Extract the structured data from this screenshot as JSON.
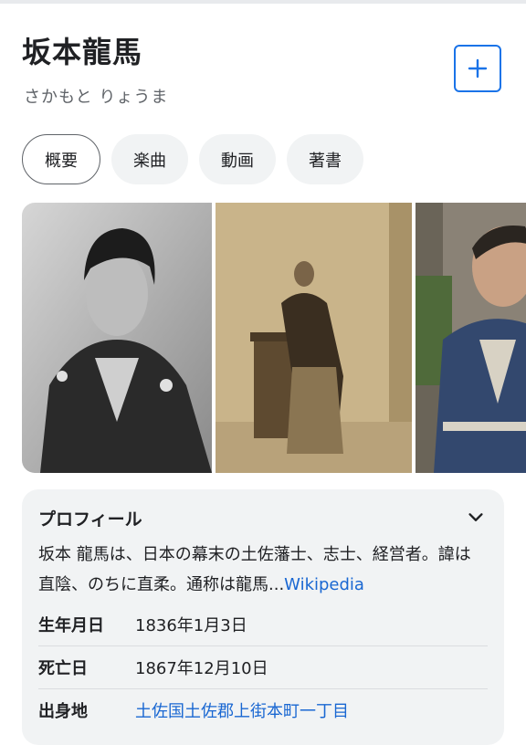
{
  "header": {
    "title": "坂本龍馬",
    "reading": "さかもと りょうま",
    "add_icon": "plus-icon",
    "accent": "#1a73e8"
  },
  "tabs": [
    {
      "label": "概要",
      "active": true
    },
    {
      "label": "楽曲",
      "active": false
    },
    {
      "label": "動画",
      "active": false
    },
    {
      "label": "著書",
      "active": false
    }
  ],
  "profile": {
    "title": "プロフィール",
    "toggle_icon": "chevron-down-icon",
    "description": "坂本 龍馬は、日本の幕末の土佐藩士、志士、経営者。諱は直陰、のちに直柔。通称は龍馬",
    "ellipsis": "...",
    "source_link": "Wikipedia",
    "facts": [
      {
        "label": "生年月日",
        "value": "1836年1月3日",
        "link": false
      },
      {
        "label": "死亡日",
        "value": "1867年12月10日",
        "link": false
      },
      {
        "label": "出身地",
        "value": "土佐国土佐郡上街本町一丁目",
        "link": true
      }
    ]
  }
}
